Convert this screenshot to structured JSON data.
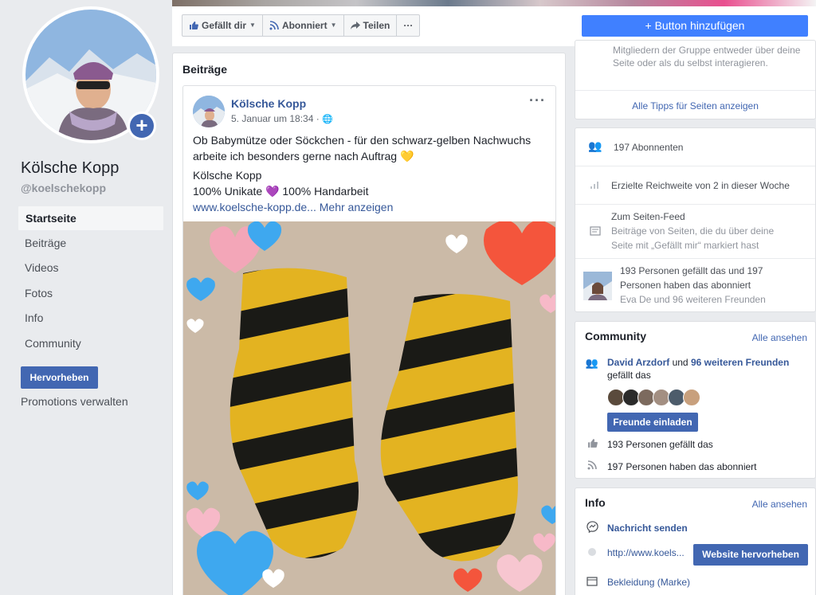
{
  "page": {
    "name": "Kölsche Kopp",
    "handle": "@koelschekopp"
  },
  "sidebar": {
    "items": [
      {
        "label": "Startseite",
        "active": true
      },
      {
        "label": "Beiträge"
      },
      {
        "label": "Videos"
      },
      {
        "label": "Fotos"
      },
      {
        "label": "Info"
      },
      {
        "label": "Community"
      }
    ],
    "promote_label": "Hervorheben",
    "promotions_label": "Promotions verwalten"
  },
  "actions": {
    "like_label": "Gefällt dir",
    "subscribe_label": "Abonniert",
    "share_label": "Teilen",
    "more_label": "···",
    "add_button_label": "+ Button hinzufügen"
  },
  "feed": {
    "title": "Beiträge",
    "post": {
      "author": "Kölsche Kopp",
      "date": "5. Januar um 18:34 · ",
      "text1": "Ob Babymütze oder Söckchen - für den schwarz-gelben Nachwuchs arbeite ich besonders gerne nach Auftrag 💛",
      "text2": "Kölsche Kopp",
      "text3": "100% Unikate 💜 100% Handarbeit",
      "link": "www.koelsche-kopp.de...",
      "more_link": " Mehr anzeigen"
    }
  },
  "tips": {
    "text": "Mitgliedern der Gruppe entweder über deine Seite oder als du selbst interagieren.",
    "link": "Alle Tipps für Seiten anzeigen"
  },
  "stats": {
    "followers": "197 Abonnenten",
    "reach": "Erzielte Reichweite von 2 in dieser Woche",
    "feed_title": "Zum Seiten-Feed",
    "feed_sub": "Beiträge von Seiten, die du über deine Seite mit „Gefällt mir“ markiert hast",
    "likes_summary": "193 Personen gefällt das und 197 Personen haben das abonniert",
    "friends_sub": "Eva De und 96 weiteren Freunden"
  },
  "community": {
    "title": "Community",
    "see_all": "Alle ansehen",
    "friend_name": "David Arzdorf",
    "and": " und ",
    "more_friends": "96 weiteren Freunden",
    "likes_this": "gefällt das",
    "invite_label": "Freunde einladen",
    "likes_count": "193 Personen gefällt das",
    "followers_count": "197 Personen haben das abonniert"
  },
  "info": {
    "title": "Info",
    "see_all": "Alle ansehen",
    "message": "Nachricht senden",
    "website": "http://www.koels...",
    "highlight_label": "Website hervorheben",
    "category": "Bekleidung (Marke)"
  },
  "colors": {
    "brand_blue": "#4267b2",
    "link_blue": "#365899",
    "accent_blue": "#4080ff",
    "yellow": "#e3b321"
  }
}
